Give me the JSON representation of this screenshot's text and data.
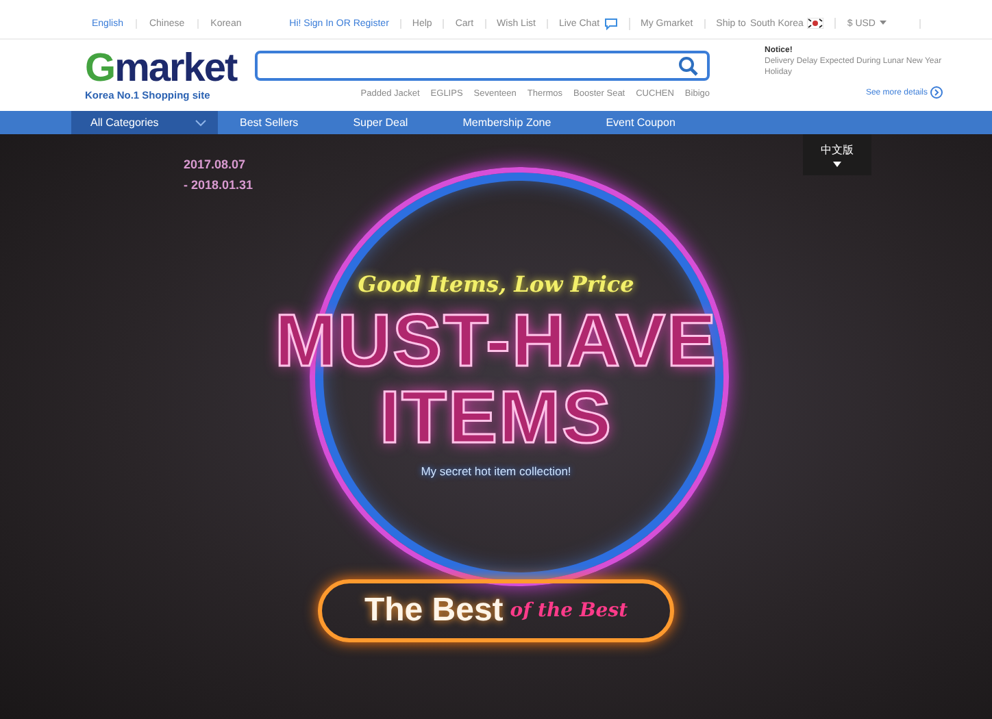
{
  "top_bar": {
    "languages": [
      {
        "label": "English",
        "selected": true
      },
      {
        "label": "Chinese",
        "selected": false
      },
      {
        "label": "Korean",
        "selected": false
      }
    ],
    "sign_in": "Hi! Sign In OR Register",
    "links": [
      "Help",
      "Cart",
      "Wish List"
    ],
    "live_chat": "Live Chat",
    "my_gmarket": "My Gmarket",
    "ship_to": "Ship to",
    "country": "South Korea",
    "currency": "$ USD"
  },
  "header": {
    "logo": "Gmarket",
    "tagline": "Korea No.1 Shopping site",
    "keywords": [
      "Padded Jacket",
      "EGLIPS",
      "Seventeen",
      "Thermos",
      "Booster Seat",
      "CUCHEN",
      "Bibigo"
    ],
    "notice": {
      "title": "Notice!",
      "text": "Delivery Delay Expected During Lunar New Year Holiday",
      "link": "See more details"
    }
  },
  "nav": {
    "items": [
      {
        "label": "All Categories",
        "selected": true
      },
      {
        "label": "Best Sellers",
        "selected": false
      },
      {
        "label": "Super Deal",
        "selected": false
      },
      {
        "label": "Membership Zone",
        "selected": false
      },
      {
        "label": "Event Coupon",
        "selected": false
      }
    ]
  },
  "banner": {
    "dates": [
      "2017.08.07",
      "- 2018.01.31"
    ],
    "language_tab": "中文版",
    "slogan": "Good Items, Low Price",
    "headline": [
      "MUST-HAVE",
      "ITEMS"
    ],
    "subtitle": "My secret hot item collection!",
    "best": "The Best",
    "best_suffix": "of the Best"
  }
}
